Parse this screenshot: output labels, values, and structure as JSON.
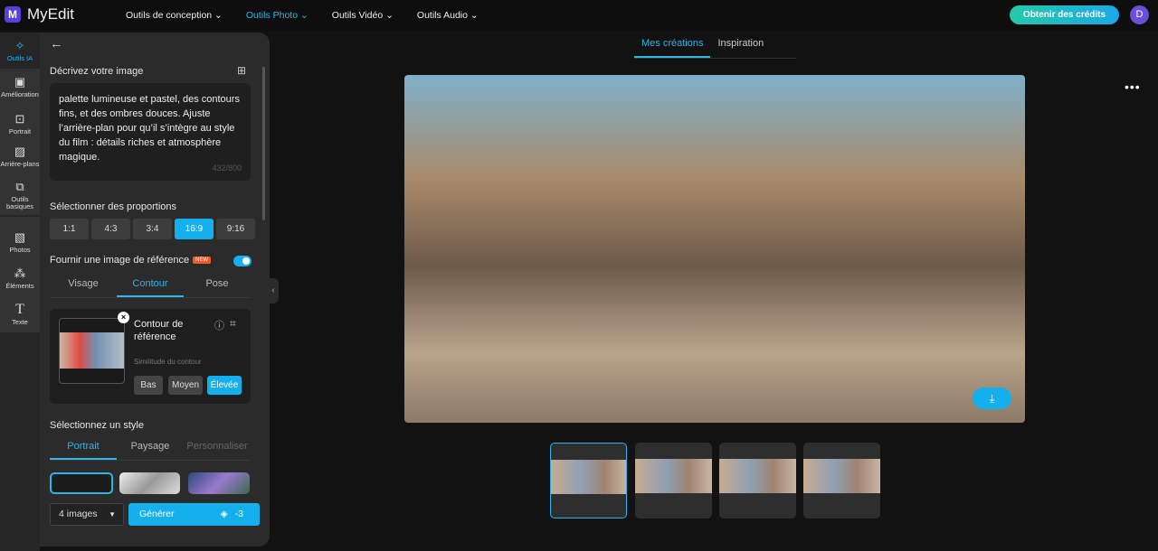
{
  "app": {
    "logo_letter": "M",
    "name": "MyEdit"
  },
  "nav": [
    {
      "label": "Outils de conception ⌄"
    },
    {
      "label": "Outils Photo ⌄"
    },
    {
      "label": "Outils Vidéo ⌄"
    },
    {
      "label": "Outils Audio ⌄"
    }
  ],
  "header": {
    "credits": "Obtenir des crédits",
    "avatar": "D"
  },
  "rail": [
    {
      "label": "Outils IA",
      "icon": "magic-wand"
    },
    {
      "label": "Amélioration",
      "icon": "image-enhance"
    },
    {
      "label": "Portrait",
      "icon": "portrait"
    },
    {
      "label": "Arrière-plans",
      "icon": "background"
    },
    {
      "label": "Outils basiques",
      "icon": "crop-tools"
    },
    {
      "label": "Photos",
      "icon": "image"
    },
    {
      "label": "Éléments",
      "icon": "shapes"
    },
    {
      "label": "Texte",
      "icon": "text"
    }
  ],
  "panel": {
    "describe_label": "Décrivez votre image",
    "prompt": "palette lumineuse et pastel, des contours fins, et des ombres douces. Ajuste l’arrière-plan pour qu’il s’intègre au style du film : détails riches et atmosphère magique.",
    "char_count": "432/800",
    "ratio_label": "Sélectionner des proportions",
    "ratios": [
      "1:1",
      "4:3",
      "3:4",
      "16:9",
      "9:16"
    ],
    "selected_ratio": "16:9",
    "reference_label": "Fournir une image de référence",
    "new_badge": "NEW",
    "reference_enabled": true,
    "ref_tabs": [
      "Visage",
      "Contour",
      "Pose"
    ],
    "ref_title": "Contour de référence",
    "similarity_label": "Similitude du contour",
    "levels": [
      "Bas",
      "Moyen",
      "Élevée"
    ],
    "selected_level": "Élevée",
    "style_label": "Sélectionnez un style",
    "style_tabs": [
      "Portrait",
      "Paysage",
      "Personnaliser"
    ],
    "count_select": "4 images",
    "generate": "Générer",
    "cost": "-3"
  },
  "main": {
    "tabs": [
      "Mes créations",
      "Inspiration"
    ],
    "more": "•••",
    "download_icon": "download"
  },
  "colors": {
    "accent": "#14b0ee",
    "brand": "#5b3fd9"
  }
}
